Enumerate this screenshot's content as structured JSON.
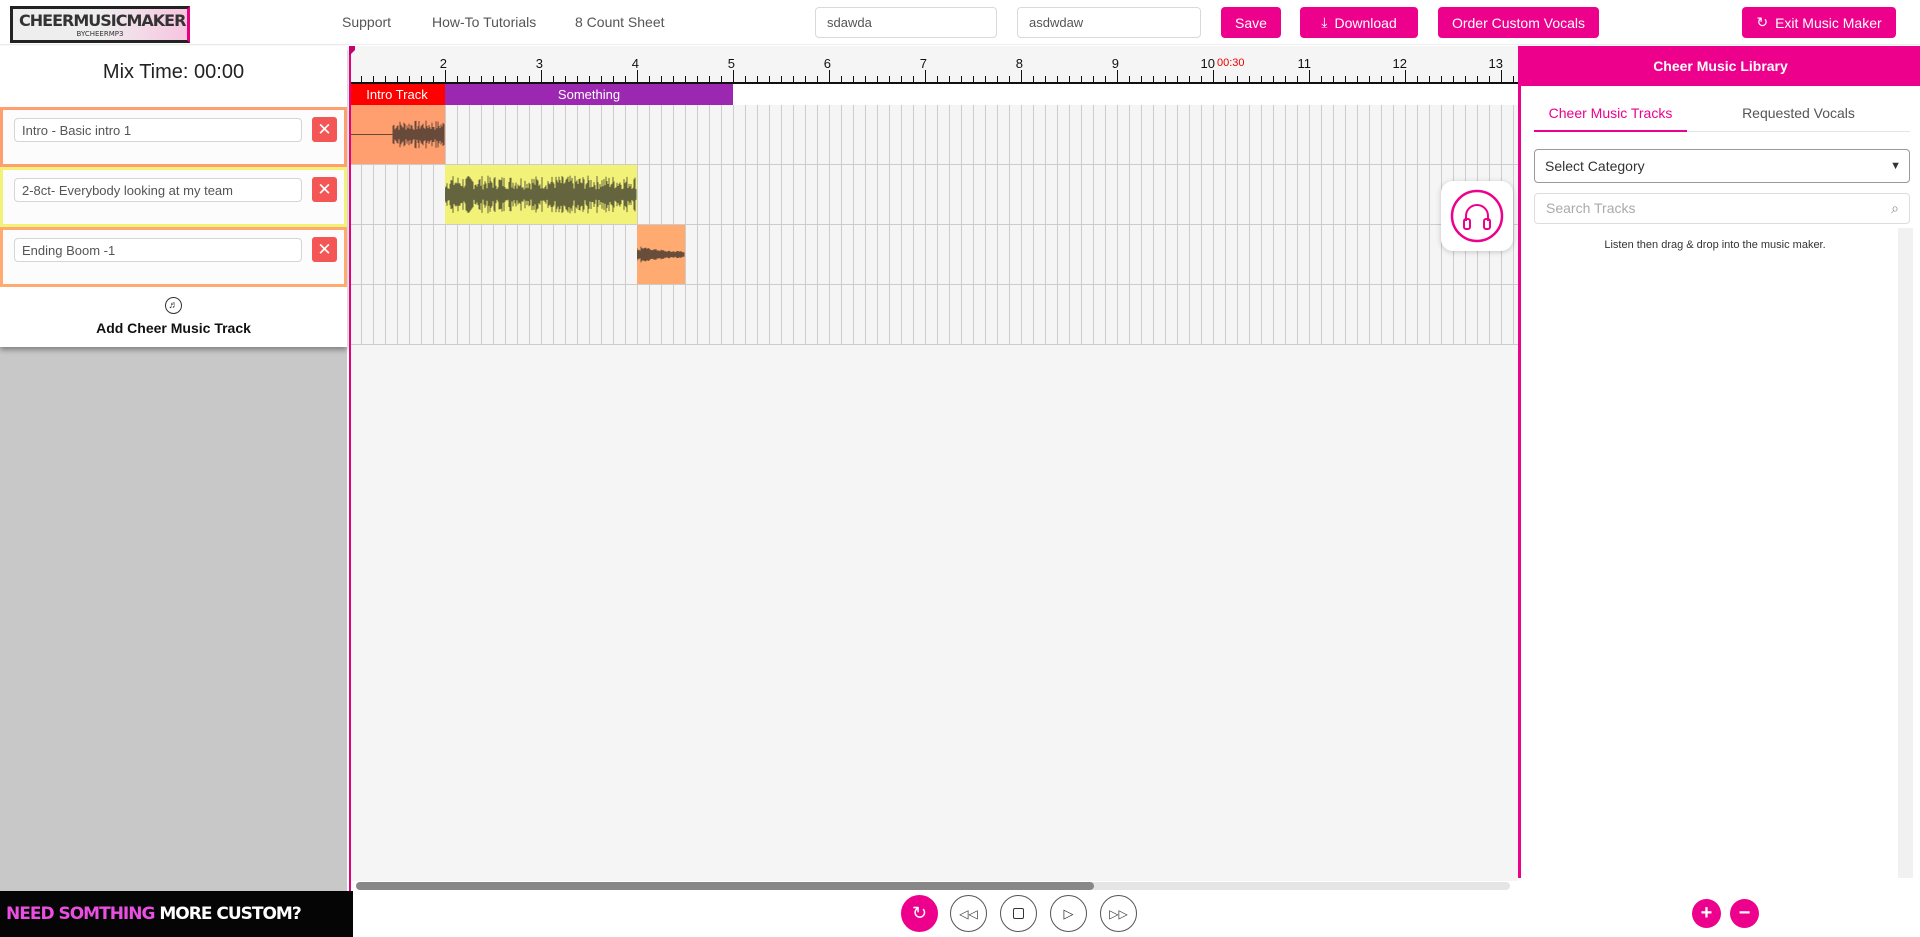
{
  "header": {
    "logo": {
      "main": "CHEERMUSICMAKER",
      "sub": "BYCHEERMP3"
    },
    "nav": [
      "Support",
      "How-To Tutorials",
      "8 Count Sheet"
    ],
    "input1": "sdawda",
    "input2": "asdwdaw",
    "save": "Save",
    "download": "Download",
    "order": "Order Custom Vocals",
    "exit": "Exit Music Maker"
  },
  "left": {
    "mix_time": "Mix Time: 00:00",
    "tracks": [
      {
        "name": "Intro - Basic intro 1",
        "color": "#ff9f70"
      },
      {
        "name": "2-8ct- Everybody looking at my team",
        "color": "#f2f279"
      },
      {
        "name": "Ending Boom -1",
        "color": "#ffaa70"
      }
    ],
    "add_track": "Add Cheer Music Track",
    "banner": {
      "pink": "NEED SOMTHING",
      "white": " MORE CUSTOM?"
    }
  },
  "timeline": {
    "ticks": [
      "2",
      "3",
      "4",
      "5",
      "6",
      "7",
      "8",
      "9",
      "10",
      "11",
      "12",
      "13"
    ],
    "marker_time": "00:30",
    "sections": [
      {
        "label": "Intro Track",
        "start": 1,
        "end": 2,
        "color": "#ff0000"
      },
      {
        "label": "Something",
        "start": 2,
        "end": 5,
        "color": "#9c27b0"
      }
    ],
    "clips": [
      {
        "row": 0,
        "start": 1,
        "end": 2,
        "color": "#ff9f70"
      },
      {
        "row": 1,
        "start": 2,
        "end": 4,
        "color": "#f2f279"
      },
      {
        "row": 2,
        "start": 4,
        "end": 4.5,
        "color": "#ffaa70"
      }
    ]
  },
  "library": {
    "title": "Cheer Music Library",
    "tabs": [
      "Cheer Music Tracks",
      "Requested Vocals"
    ],
    "category": "Select Category",
    "search_placeholder": "Search Tracks",
    "hint": "Listen then drag & drop into the music maker."
  },
  "accent": "#ec008c"
}
